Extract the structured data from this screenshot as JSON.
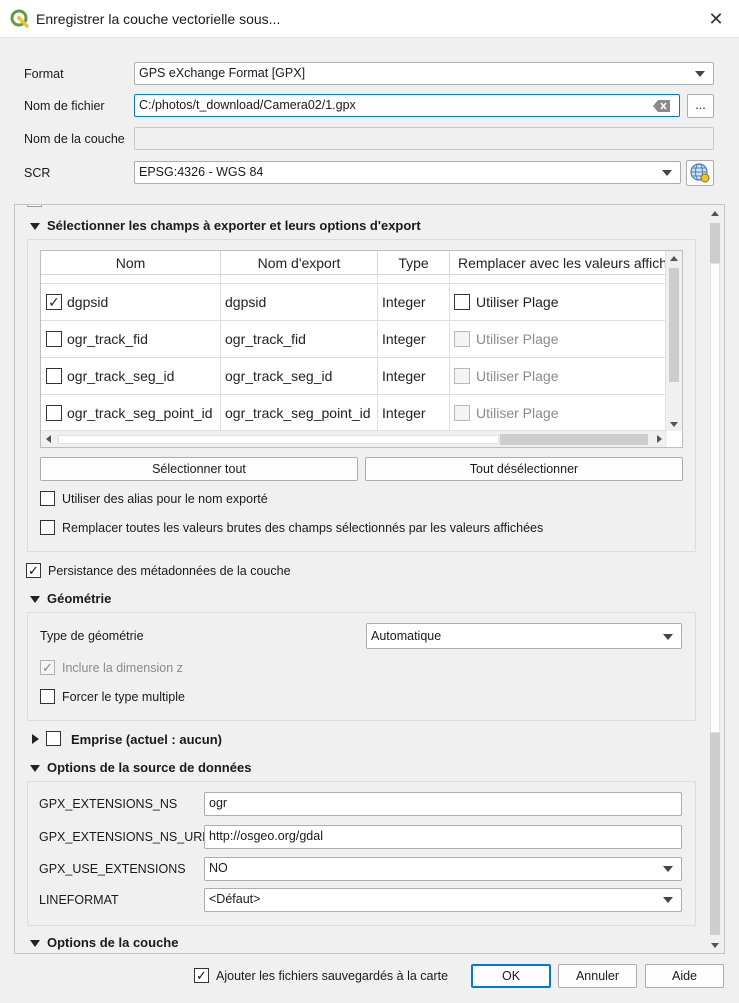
{
  "window": {
    "title": "Enregistrer la couche vectorielle sous...",
    "close_icon": "close-icon",
    "app_icon": "qgis-logo-icon"
  },
  "form": {
    "format_label": "Format",
    "format_value": "GPS eXchange Format [GPX]",
    "filename_label": "Nom de fichier",
    "filename_value": "C:/photos/t_download/Camera02/1.gpx",
    "browse_label": "...",
    "layername_label": "Nom de la couche",
    "layername_value": "",
    "crs_label": "SCR",
    "crs_value": "EPSG:4326 - WGS 84"
  },
  "fields_section": {
    "title": "Sélectionner les champs à exporter et leurs options d'export",
    "columns": [
      "Nom",
      "Nom d'export",
      "Type",
      "Remplacer avec les valeurs affichées"
    ],
    "rows": [
      {
        "name": "dgpsid",
        "export_name": "dgpsid",
        "type": "Integer",
        "replace_label": "Utiliser Plage",
        "checked": true,
        "replace_enabled": true
      },
      {
        "name": "ogr_track_fid",
        "export_name": "ogr_track_fid",
        "type": "Integer",
        "replace_label": "Utiliser Plage",
        "checked": false,
        "replace_enabled": false
      },
      {
        "name": "ogr_track_seg_id",
        "export_name": "ogr_track_seg_id",
        "type": "Integer",
        "replace_label": "Utiliser Plage",
        "checked": false,
        "replace_enabled": false
      },
      {
        "name": "ogr_track_seg_point_id",
        "export_name": "ogr_track_seg_point_id",
        "type": "Integer",
        "replace_label": "Utiliser Plage",
        "checked": false,
        "replace_enabled": false
      }
    ],
    "select_all": "Sélectionner tout",
    "deselect_all": "Tout désélectionner",
    "use_alias": "Utiliser des alias pour le nom exporté",
    "replace_all": "Remplacer toutes les valeurs brutes des champs sélectionnés par les valeurs affichées"
  },
  "metadata_persist": "Persistance des métadonnées de la couche",
  "geometry": {
    "title": "Géométrie",
    "type_label": "Type de géométrie",
    "type_value": "Automatique",
    "include_z": "Inclure la dimension z",
    "force_multi": "Forcer le type multiple"
  },
  "extent": {
    "title": "Emprise (actuel : aucun)"
  },
  "datasource": {
    "title": "Options de la source de données",
    "options": [
      {
        "label": "GPX_EXTENSIONS_NS",
        "value": "ogr",
        "kind": "text"
      },
      {
        "label": "GPX_EXTENSIONS_NS_URL",
        "value": "http://osgeo.org/gdal",
        "kind": "text"
      },
      {
        "label": "GPX_USE_EXTENSIONS",
        "value": "NO",
        "kind": "combo"
      },
      {
        "label": "LINEFORMAT",
        "value": "<Défaut>",
        "kind": "combo"
      }
    ]
  },
  "layer_options": {
    "title": "Options de la couche"
  },
  "footer": {
    "add_to_map": "Ajouter les fichiers sauvegardés à la carte",
    "ok": "OK",
    "cancel": "Annuler",
    "help": "Aide"
  },
  "colors": {
    "accent": "#0078d7",
    "qgis_green": "#5f9f3a",
    "qgis_yellow": "#f0c330"
  }
}
